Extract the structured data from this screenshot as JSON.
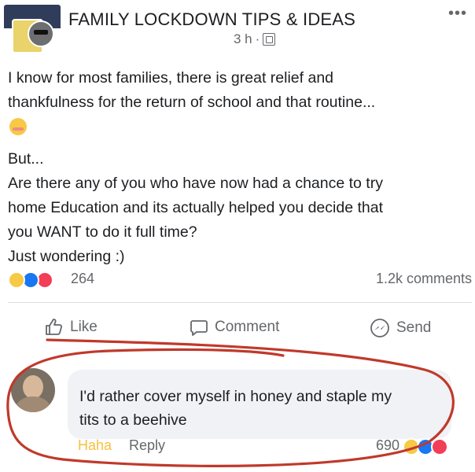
{
  "post": {
    "group_name": "FAMILY LOCKDOWN TIPS & IDEAS",
    "time": "3 h",
    "separator": "·",
    "more": "•••",
    "lines": [
      "I know for most families, there is great relief and",
      "thankfulness for the return of school and that routine..."
    ],
    "lines2": [
      "But...",
      "Are there any of you who have now had a chance to try",
      "home Education and its actually helped you decide that",
      "you WANT to do it full time?",
      "Just wondering :)"
    ]
  },
  "stats": {
    "reaction_count": "264",
    "comment_count": "1.2k comments"
  },
  "actions": {
    "like": "Like",
    "comment": "Comment",
    "send": "Send"
  },
  "comment": {
    "line1": "I'd rather cover myself in honey and staple my",
    "line2": "tits to a beehive",
    "haha": "Haha",
    "reply": "Reply",
    "reaction_count": "690"
  },
  "colors": {
    "haha_yellow": "#f7c03e",
    "like_blue": "#1877f2",
    "love_red": "#f33e58",
    "annotation_red": "#c0392b"
  }
}
